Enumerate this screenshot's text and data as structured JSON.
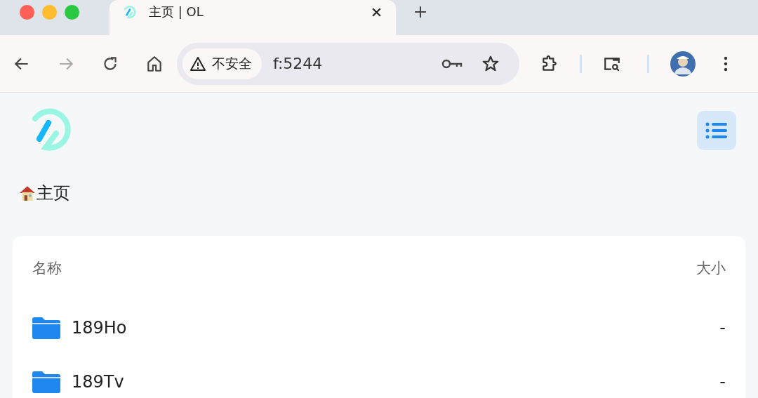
{
  "tab": {
    "title": "主页 | OL",
    "selected": true
  },
  "address_bar": {
    "security": "不安全",
    "url": "f:5244"
  },
  "breadcrumb": "主页",
  "table": {
    "columns": [
      "名称",
      "大小"
    ],
    "rows": [
      {
        "name": "189Ho",
        "size": "-"
      },
      {
        "name": "189Tv",
        "size": "-"
      }
    ]
  }
}
